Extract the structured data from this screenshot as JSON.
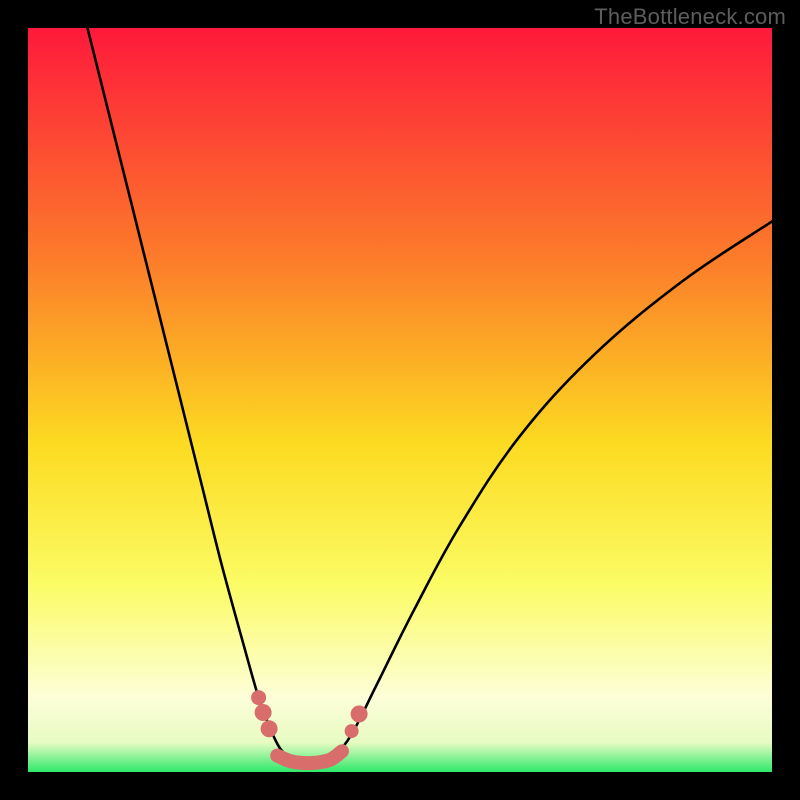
{
  "watermark": "TheBottleneck.com",
  "colors": {
    "background": "#000000",
    "gradient_top": "#fe193b",
    "gradient_mid_upper": "#fc7f2a",
    "gradient_mid": "#fcdb21",
    "gradient_mid_lower": "#fbfc66",
    "gradient_pale": "#e8fbc3",
    "gradient_base": "#2ee96a",
    "curve": "#000000",
    "marker": "#d86d6b",
    "marker_stroke": "#923f3d",
    "watermark": "#5d5d5d"
  },
  "chart_data": {
    "type": "line",
    "title": "",
    "xlabel": "",
    "ylabel": "",
    "xlim": [
      0,
      100
    ],
    "ylim": [
      0,
      100
    ],
    "left_curve": {
      "x": [
        8,
        11,
        14,
        17,
        20,
        23,
        26,
        29,
        31,
        32.5,
        34,
        36,
        38
      ],
      "y": [
        100,
        88,
        76,
        64,
        52,
        40,
        28,
        17,
        10,
        6,
        3,
        1.5,
        1
      ]
    },
    "right_curve": {
      "x": [
        38,
        40,
        42,
        44,
        47,
        52,
        58,
        66,
        76,
        88,
        100
      ],
      "y": [
        1,
        1.5,
        3,
        6,
        12,
        22,
        33,
        45,
        56,
        66,
        74
      ]
    },
    "notch": {
      "left_markers": [
        {
          "x": 31.0,
          "y": 10.0
        },
        {
          "x": 31.6,
          "y": 8.0
        },
        {
          "x": 32.4,
          "y": 5.8
        }
      ],
      "right_markers": [
        {
          "x": 43.5,
          "y": 5.5
        },
        {
          "x": 44.5,
          "y": 7.8
        }
      ],
      "bottom_link": [
        {
          "x": 33.5,
          "y": 2.2
        },
        {
          "x": 35.5,
          "y": 1.4
        },
        {
          "x": 38.0,
          "y": 1.2
        },
        {
          "x": 40.5,
          "y": 1.6
        },
        {
          "x": 42.2,
          "y": 2.8
        }
      ]
    }
  }
}
